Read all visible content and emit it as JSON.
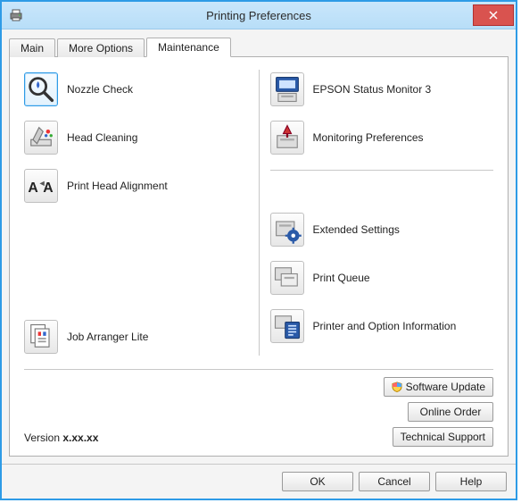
{
  "window": {
    "title": "Printing Preferences"
  },
  "tabs": {
    "main": "Main",
    "more_options": "More Options",
    "maintenance": "Maintenance",
    "active": "maintenance"
  },
  "left_items": {
    "nozzle_check": "Nozzle Check",
    "head_cleaning": "Head Cleaning",
    "print_head_alignment": "Print Head Alignment",
    "job_arranger_lite": "Job Arranger Lite"
  },
  "right_items": {
    "status_monitor": "EPSON Status Monitor 3",
    "monitoring_preferences": "Monitoring Preferences",
    "extended_settings": "Extended Settings",
    "print_queue": "Print Queue",
    "printer_option_info": "Printer and Option Information"
  },
  "side_buttons": {
    "software_update": "Software Update",
    "online_order": "Online Order",
    "technical_support": "Technical Support"
  },
  "version": {
    "label": "Version ",
    "value": "x.xx.xx"
  },
  "footer": {
    "ok": "OK",
    "cancel": "Cancel",
    "help": "Help"
  }
}
